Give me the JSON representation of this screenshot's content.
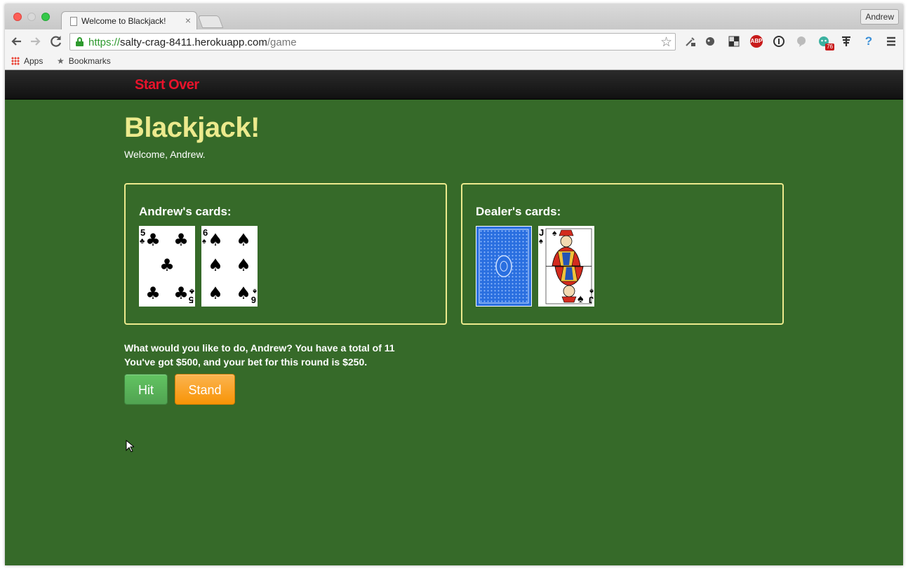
{
  "browser": {
    "tab_title": "Welcome to Blackjack!",
    "tab_close": "×",
    "profile_name": "Andrew",
    "url_scheme": "https://",
    "url_host": "salty-crag-8411.herokuapp.com",
    "url_path": "/game",
    "bookmarks": [
      {
        "label": "Apps",
        "icon": "apps-grid-icon"
      },
      {
        "label": "Bookmarks",
        "icon": "star-icon"
      }
    ],
    "extension_badge": "76",
    "extension_abp": "ABP"
  },
  "site_nav": {
    "start_over": "Start Over",
    "start_over_color": "#e8132b"
  },
  "page": {
    "title": "Blackjack!",
    "welcome": "Welcome, Andrew.",
    "player_heading": "Andrew's cards:",
    "dealer_heading": "Dealer's cards:",
    "player_cards": [
      {
        "rank": "5",
        "suit": "clubs",
        "suit_symbol": "♣"
      },
      {
        "rank": "6",
        "suit": "spades",
        "suit_symbol": "♠"
      }
    ],
    "dealer_cards": [
      {
        "face_down": true,
        "back_color": "#2a6fe0"
      },
      {
        "rank": "J",
        "suit": "spades",
        "suit_symbol": "♠"
      }
    ],
    "prompt_line1": "What would you like to do, Andrew? You have a total of 11",
    "prompt_line2": "You've got $500, and your bet for this round is $250.",
    "hit_label": "Hit",
    "stand_label": "Stand"
  },
  "colors": {
    "table_green": "#366a29",
    "title_yellow": "#ecea8d",
    "hit_green": "#51a351",
    "stand_orange": "#f89406"
  }
}
